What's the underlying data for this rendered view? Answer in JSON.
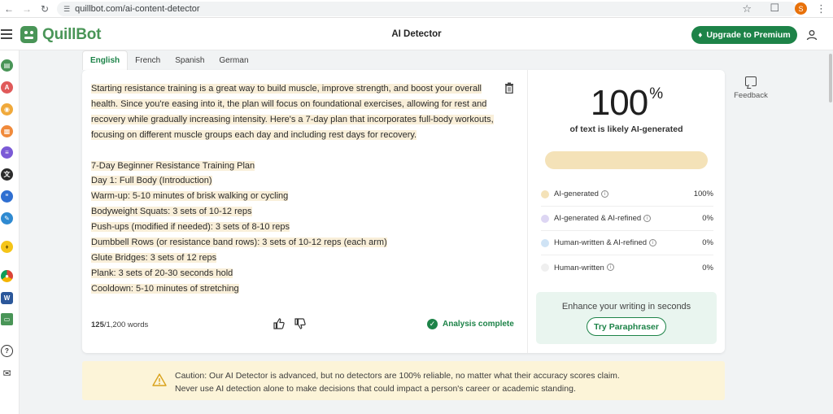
{
  "browser": {
    "url": "quillbot.com/ai-content-detector",
    "profile_initial": "S"
  },
  "header": {
    "logo_text": "QuillBot",
    "page_title": "AI Detector",
    "premium_label": "Upgrade to Premium"
  },
  "tabs": [
    "English",
    "French",
    "Spanish",
    "German"
  ],
  "editor": {
    "paragraph": "Starting resistance training is a great way to build muscle, improve strength, and boost your overall health. Since you're easing into it, the plan will focus on foundational exercises, allowing for rest and recovery while gradually increasing intensity. Here's a 7-day plan that incorporates full-body workouts, focusing on different muscle groups each day and including rest days for recovery.",
    "lines": [
      "7-Day Beginner Resistance Training Plan",
      "Day 1: Full Body (Introduction)",
      "Warm-up: 5-10 minutes of brisk walking or cycling",
      "Bodyweight Squats: 3 sets of 10-12 reps",
      "Push-ups (modified if needed): 3 sets of 8-10 reps",
      "Dumbbell Rows (or resistance band rows): 3 sets of 10-12 reps (each arm)",
      "Glute Bridges: 3 sets of 12 reps",
      "Plank: 3 sets of 20-30 seconds hold",
      "Cooldown: 5-10 minutes of stretching"
    ],
    "word_count": "125",
    "word_limit": "/1,200 words",
    "status": "Analysis complete"
  },
  "results": {
    "percent": "100",
    "percent_sign": "%",
    "percent_label": "of text is likely AI-generated",
    "legend": [
      {
        "label": "AI-generated",
        "value": "100%",
        "color": "#f4e2b8"
      },
      {
        "label": "AI-generated & AI-refined",
        "value": "0%",
        "color": "#ddd6f3"
      },
      {
        "label": "Human-written & AI-refined",
        "value": "0%",
        "color": "#cfe3f5"
      },
      {
        "label": "Human-written",
        "value": "0%",
        "color": "#efefef"
      }
    ],
    "enhance_text": "Enhance your writing in seconds",
    "enhance_button": "Try Paraphraser"
  },
  "feedback_label": "Feedback",
  "caution": {
    "line1": "Caution: Our AI Detector is advanced, but no detectors are 100% reliable, no matter what their accuracy scores claim.",
    "line2": "Never use AI detection alone to make decisions that could impact a person's career or academic standing."
  },
  "colors": {
    "brand_green": "#1d8348",
    "logo_green": "#499557",
    "highlight": "#f9efd9"
  }
}
